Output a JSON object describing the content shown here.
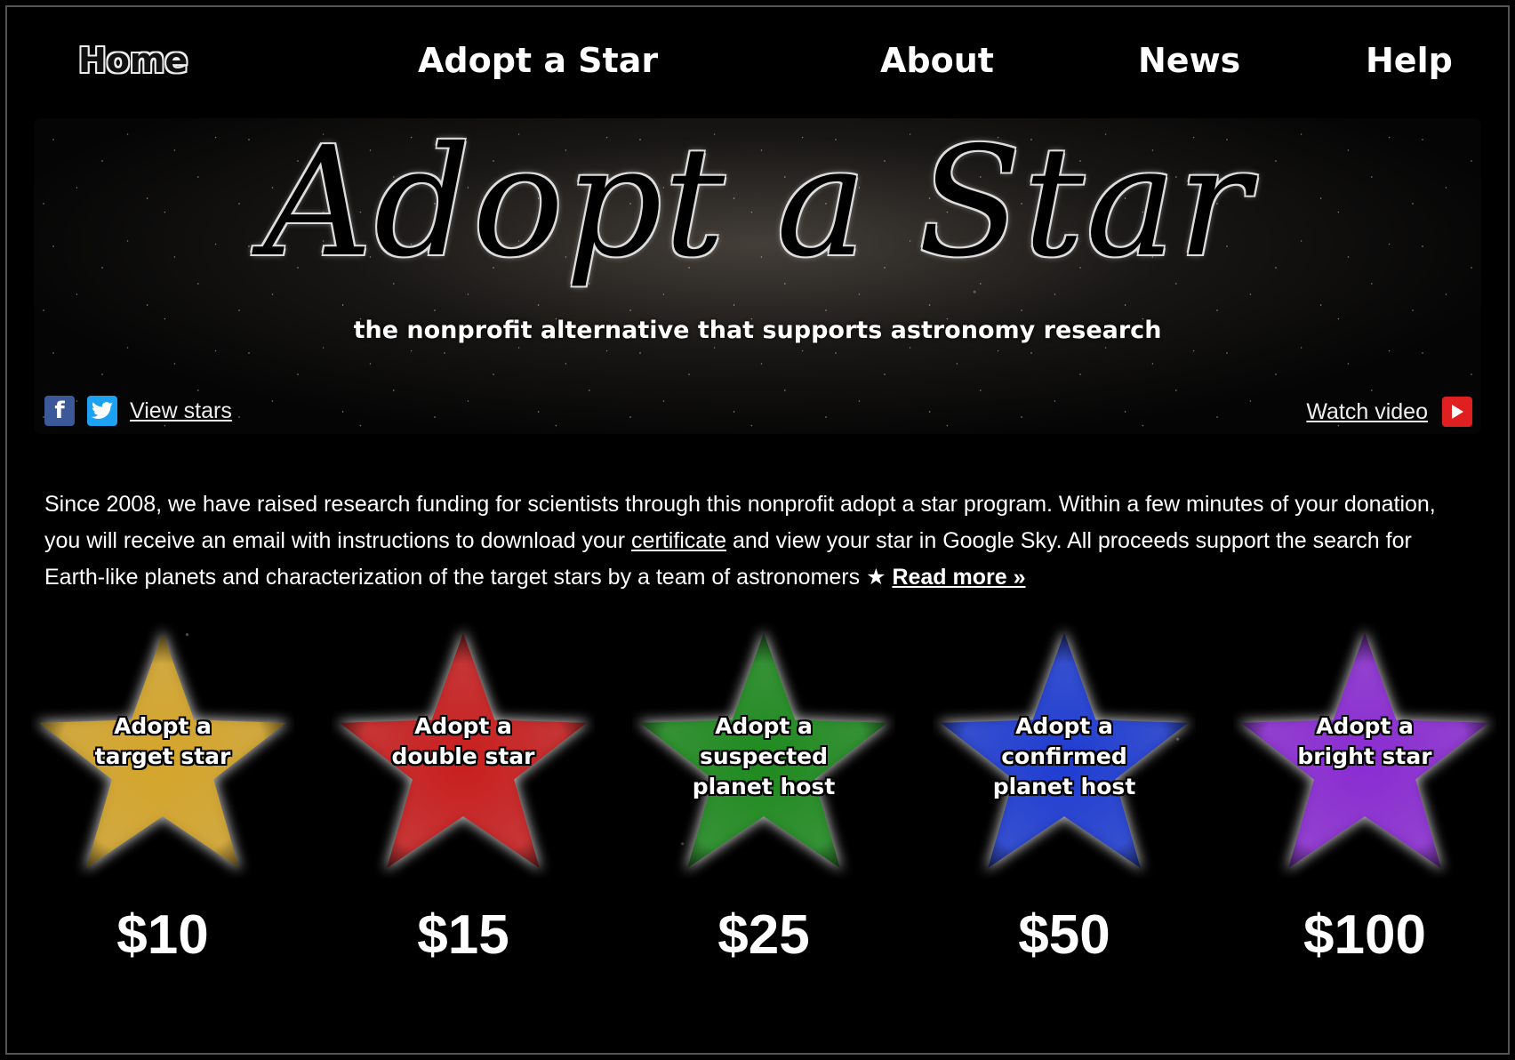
{
  "nav": {
    "home": "Home",
    "adopt": "Adopt a Star",
    "about": "About",
    "news": "News",
    "help": "Help"
  },
  "banner": {
    "title": "Adopt a Star",
    "tagline": "the nonprofit alternative that supports astronomy research"
  },
  "social": {
    "facebook_icon": "facebook-icon",
    "twitter_icon": "twitter-icon",
    "view_stars": "View stars",
    "watch_video": "Watch video",
    "youtube_icon": "youtube-play-icon"
  },
  "intro": {
    "part1": "Since 2008, we have raised research funding for scientists through this nonprofit adopt a star program. Within a few minutes of your donation, you will receive an email with instructions to download your ",
    "certificate": "certificate",
    "part2": " and view your star in Google Sky. All proceeds support the search for Earth-like planets and characterization of the target stars by a team of astronomers ★ ",
    "read_more": "Read more »"
  },
  "stars": [
    {
      "label": "Adopt a target star",
      "lines": [
        "Adopt a",
        "target star"
      ],
      "price": "$10",
      "color": "#d4a52a"
    },
    {
      "label": "Adopt a double star",
      "lines": [
        "Adopt a",
        "double star"
      ],
      "price": "$15",
      "color": "#c81e1e"
    },
    {
      "label": "Adopt a suspected planet host",
      "lines": [
        "Adopt a",
        "suspected",
        "planet host"
      ],
      "price": "$25",
      "color": "#1e8a1e"
    },
    {
      "label": "Adopt a confirmed planet host",
      "lines": [
        "Adopt a",
        "confirmed",
        "planet host"
      ],
      "price": "$50",
      "color": "#1e3cd2"
    },
    {
      "label": "Adopt a bright star",
      "lines": [
        "Adopt a",
        "bright star"
      ],
      "price": "$100",
      "color": "#8a2bd2"
    }
  ]
}
